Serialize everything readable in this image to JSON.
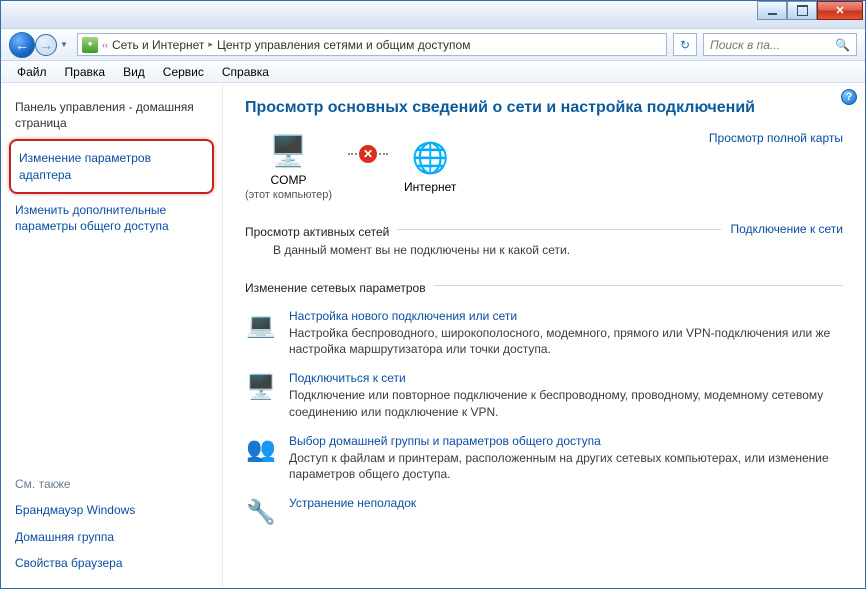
{
  "titlebar": {
    "min": "",
    "max": "",
    "close": ""
  },
  "nav": {
    "breadcrumb": [
      "Сеть и Интернет",
      "Центр управления сетями и общим доступом"
    ],
    "search_placeholder": "Поиск в па...",
    "refresh_glyph": "↻"
  },
  "menubar": [
    "Файл",
    "Правка",
    "Вид",
    "Сервис",
    "Справка"
  ],
  "sidebar": {
    "home": "Панель управления - домашняя страница",
    "highlighted": "Изменение параметров адаптера",
    "link2": "Изменить дополнительные параметры общего доступа",
    "see_also": "См. также",
    "sub": [
      "Брандмауэр Windows",
      "Домашняя группа",
      "Свойства браузера"
    ]
  },
  "main": {
    "title": "Просмотр основных сведений о сети и настройка подключений",
    "full_map": "Просмотр полной карты",
    "node_comp": {
      "label": "COMP",
      "sub": "(этот компьютер)"
    },
    "node_net": {
      "label": "Интернет"
    },
    "active_head": "Просмотр активных сетей",
    "connect_link": "Подключение к сети",
    "active_text": "В данный момент вы не подключены ни к какой сети.",
    "change_head": "Изменение сетевых параметров",
    "items": [
      {
        "title": "Настройка нового подключения или сети",
        "desc": "Настройка беспроводного, широкополосного, модемного, прямого или VPN-подключения или же настройка маршрутизатора или точки доступа."
      },
      {
        "title": "Подключиться к сети",
        "desc": "Подключение или повторное подключение к беспроводному, проводному, модемному сетевому соединению или подключение к VPN."
      },
      {
        "title": "Выбор домашней группы и параметров общего доступа",
        "desc": "Доступ к файлам и принтерам, расположенным на других сетевых компьютерах, или изменение параметров общего доступа."
      },
      {
        "title": "Устранение неполадок",
        "desc": ""
      }
    ]
  }
}
